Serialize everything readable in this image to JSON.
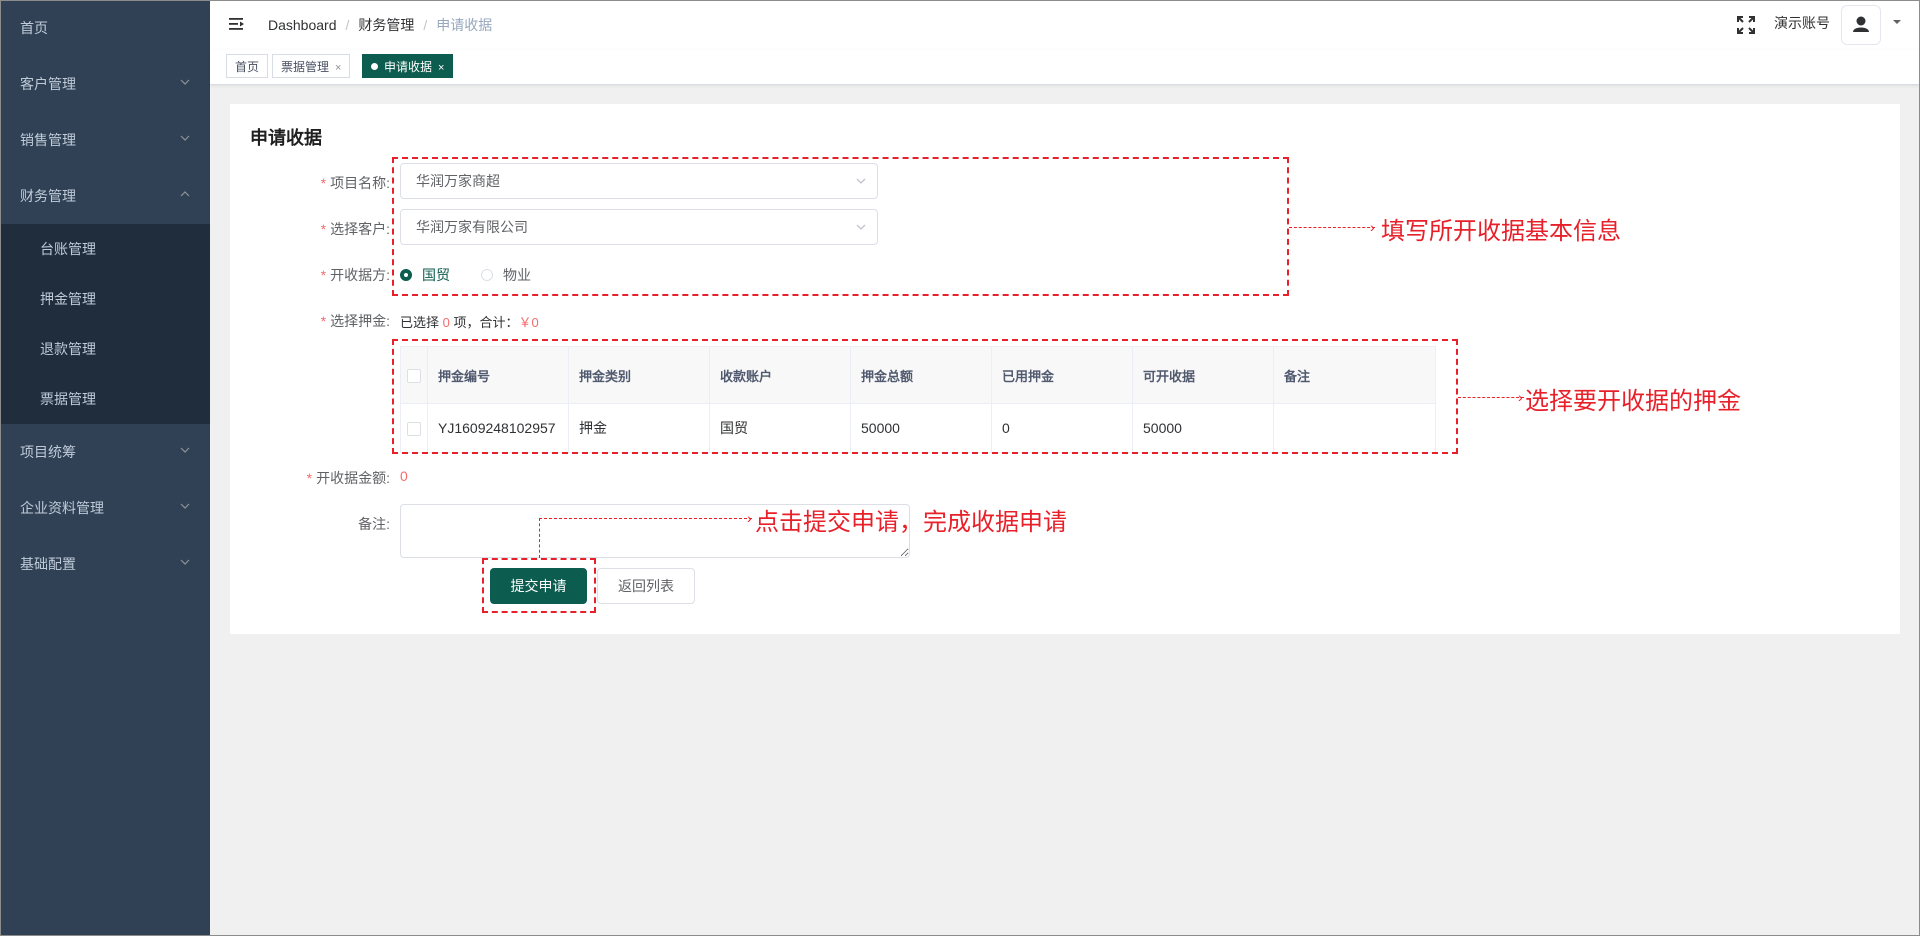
{
  "sidebar": {
    "items": [
      {
        "label": "首页",
        "has_arrow": false
      },
      {
        "label": "客户管理",
        "has_arrow": true
      },
      {
        "label": "销售管理",
        "has_arrow": true
      },
      {
        "label": "财务管理",
        "has_arrow": true,
        "expanded": true
      }
    ],
    "finance_sub": [
      "台账管理",
      "押金管理",
      "退款管理",
      "票据管理"
    ],
    "items_after": [
      "项目统筹",
      "企业资料管理",
      "基础配置"
    ],
    "colors": {
      "bg": "#304156",
      "sub_bg": "#1f2d3d",
      "text": "#bfcbd9"
    }
  },
  "header": {
    "breadcrumb": [
      "Dashboard",
      "财务管理",
      "申请收据"
    ],
    "account_name": "演示账号",
    "icons": [
      "hamburger-icon",
      "fullscreen-icon",
      "user-icon",
      "caret-down-icon"
    ]
  },
  "tags": [
    {
      "label": "首页",
      "active": false,
      "closable": false
    },
    {
      "label": "票据管理",
      "active": false,
      "closable": true
    },
    {
      "label": "申请收据",
      "active": true,
      "closable": true
    }
  ],
  "form": {
    "title": "申请收据",
    "project_label": "项目名称:",
    "project_value": "华润万家商超",
    "customer_label": "选择客户:",
    "customer_value": "华润万家有限公司",
    "issuer_label": "开收据方:",
    "issuer_options": [
      "国贸",
      "物业"
    ],
    "issuer_selected": "国贸",
    "deposit_label": "选择押金:",
    "deposit_summary": {
      "prefix": "已选择 ",
      "count": "0",
      "middle": " 项，合计：",
      "total": "￥0"
    },
    "amount_label": "开收据金额:",
    "amount_value": "0",
    "remark_label": "备注:",
    "remark_value": "",
    "submit_label": "提交申请",
    "back_label": "返回列表"
  },
  "deposit_table": {
    "headers": [
      "押金编号",
      "押金类别",
      "收款账户",
      "押金总额",
      "已用押金",
      "可开收据",
      "备注"
    ],
    "rows": [
      [
        "YJ1609248102957",
        "押金",
        "国贸",
        "50000",
        "0",
        "50000",
        ""
      ]
    ]
  },
  "annotations": {
    "basic_info": "填写所开收据基本信息",
    "select_deposit": "选择要开收据的押金",
    "submit": "点击提交申请，完成收据申请",
    "color": "#e8202a"
  },
  "theme": {
    "primary": "#0c5c4f",
    "required": "#f56c6c"
  }
}
